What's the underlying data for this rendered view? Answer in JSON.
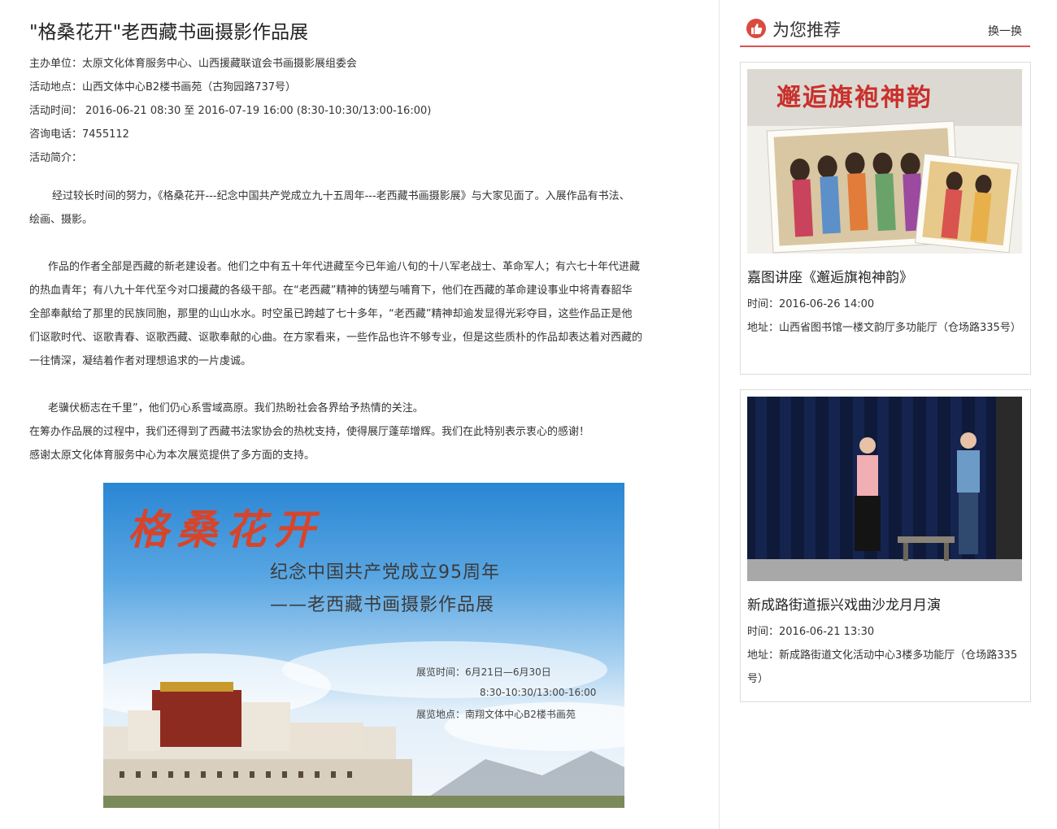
{
  "article": {
    "title": "\"格桑花开\"老西藏书画摄影作品展",
    "organizer": "主办单位：太原文化体育服务中心、山西援藏联谊会书画摄影展组委会",
    "location": "活动地点：山西文体中心B2楼书画苑（古狗园路737号）",
    "time": "活动时间： 2016-06-21 08:30 至 2016-07-19 16:00 (8:30-10:30/13:00-16:00)",
    "phone": "咨询电话：7455112",
    "intro_label": "活动简介：",
    "para1_l1": "经过较长时间的努力，《格桑花开---纪念中国共产党成立九十五周年---老西藏书画摄影展》与大家见面了。入展作品有书法、",
    "para1_l2": "绘画、摄影。",
    "para2_l1": "作品的作者全部是西藏的新老建设者。他们之中有五十年代进藏至今已年逾八旬的十八军老战士、革命军人；有六七十年代进藏",
    "para2_l2": "的热血青年；有八九十年代至今对口援藏的各级干部。在“老西藏”精神的铸塑与哺育下，他们在西藏的革命建设事业中将青春韶华",
    "para2_l3": "全部奉献给了那里的民族同胞，那里的山山水水。时空虽已跨越了七十多年，“老西藏”精神却逾发显得光彩夺目，这些作品正是他",
    "para2_l4": "们讴歌时代、讴歌青春、讴歌西藏、讴歌奉献的心曲。在方家看来，一些作品也许不够专业，但是这些质朴的作品却表达着对西藏的",
    "para2_l5": "一往情深，凝结着作者对理想追求的一片虔诚。",
    "para3_l1": "老骥伏枥志在千里”，他们仍心系雪域高原。我们热盼社会各界给予热情的关注。",
    "para3_l2": "在筹办作品展的过程中，我们还得到了西藏书法家协会的热枕支持，使得展厅蓬荜增辉。我们在此特别表示衷心的感谢！",
    "para3_l3": "感谢太原文化体育服务中心为本次展览提供了多方面的支持。"
  },
  "poster": {
    "title": "格桑花开",
    "subtitle1": "纪念中国共产党成立95周年",
    "subtitle2": "——老西藏书画摄影作品展",
    "info1": "展览时间：6月21日—6月30日",
    "info2": "8:30-10:30/13:00-16:00",
    "info3": "展览地点：南翔文体中心B2楼书画苑"
  },
  "sidebar": {
    "title": "为您推荐",
    "refresh_label": "换一换",
    "cards": [
      {
        "image_text": "邂逅旗袍神韵",
        "title": "嘉图讲座《邂逅旗袍神韵》",
        "time": "时间：2016-06-26 14:00",
        "address": "地址：山西省图书馆一楼文韵厅多功能厅（仓场路335号）"
      },
      {
        "title": "新成路街道振兴戏曲沙龙月月演",
        "time": "时间：2016-06-21 13:30",
        "address": "地址：新成路街道文化活动中心3楼多功能厅（仓场路335号）"
      }
    ]
  },
  "colors": {
    "accent": "#d9534f",
    "text": "#333333"
  }
}
